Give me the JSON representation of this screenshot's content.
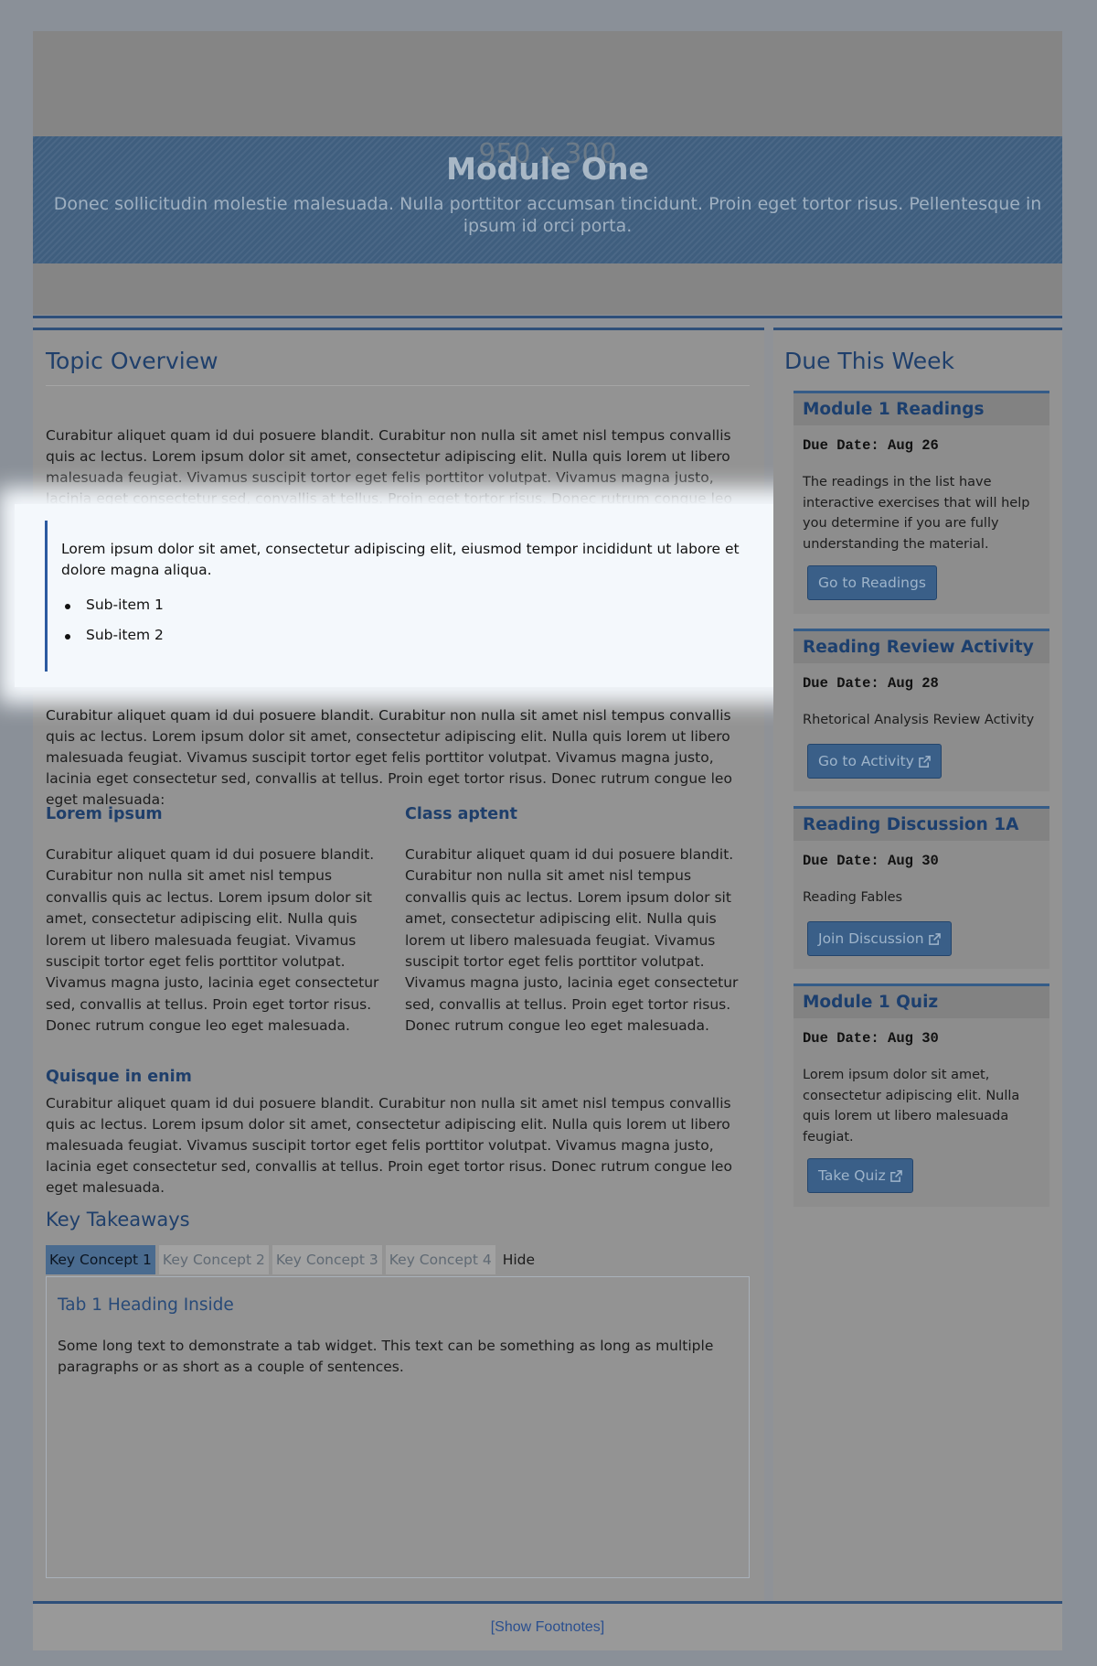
{
  "banner": {
    "placeholder": "950 x 300",
    "title": "Module One",
    "subtitle": "Donec sollicitudin molestie malesuada. Nulla porttitor accumsan tincidunt. Proin eget tortor risus. Pellentesque in ipsum id orci porta."
  },
  "topic": {
    "title": "Topic Overview",
    "para1": "Curabitur aliquet quam id dui posuere blandit. Curabitur non nulla sit amet nisl tempus convallis quis ac lectus. Lorem ipsum dolor sit amet, consectetur adipiscing elit. Nulla quis lorem ut libero malesuada feugiat. Vivamus suscipit tortor eget felis porttitor volutpat. Vivamus magna justo, lacinia eget consectetur sed, convallis at tellus. Proin eget tortor risus. Donec rutrum congue leo eget malesuada.",
    "callout_text": "Lorem ipsum dolor sit amet, consectetur adipiscing elit, eiusmod tempor incididunt ut labore et dolore magna aliqua.",
    "callout_items": [
      "Sub-item 1",
      "Sub-item 2"
    ],
    "para2": "Curabitur aliquet quam id dui posuere blandit. Curabitur non nulla sit amet nisl tempus convallis quis ac lectus. Lorem ipsum dolor sit amet, consectetur adipiscing elit. Nulla quis lorem ut libero malesuada feugiat. Vivamus suscipit tortor eget felis porttitor volutpat. Vivamus magna justo, lacinia eget consectetur sed, convallis at tellus. Proin eget tortor risus. Donec rutrum congue leo eget malesuada:",
    "col_left_heading": "Lorem ipsum",
    "col_left_text": "Curabitur aliquet quam id dui posuere blandit. Curabitur non nulla sit amet nisl tempus convallis quis ac lectus. Lorem ipsum dolor sit amet, consectetur adipiscing elit. Nulla quis lorem ut libero malesuada feugiat. Vivamus suscipit tortor eget felis porttitor volutpat. Vivamus magna justo, lacinia eget consectetur sed, convallis at tellus. Proin eget tortor risus. Donec rutrum congue leo eget malesuada.",
    "col_right_heading": "Class aptent",
    "col_right_text": "Curabitur aliquet quam id dui posuere blandit. Curabitur non nulla sit amet nisl tempus convallis quis ac lectus. Lorem ipsum dolor sit amet, consectetur adipiscing elit. Nulla quis lorem ut libero malesuada feugiat. Vivamus suscipit tortor eget felis porttitor volutpat. Vivamus magna justo, lacinia eget consectetur sed, convallis at tellus. Proin eget tortor risus. Donec rutrum congue leo eget malesuada.",
    "quisque_heading": "Quisque in enim",
    "para3": "Curabitur aliquet quam id dui posuere blandit. Curabitur non nulla sit amet nisl tempus convallis quis ac lectus. Lorem ipsum dolor sit amet, consectetur adipiscing elit. Nulla quis lorem ut libero malesuada feugiat. Vivamus suscipit tortor eget felis porttitor volutpat. Vivamus magna justo, lacinia eget consectetur sed, convallis at tellus. Proin eget tortor risus. Donec rutrum congue leo eget malesuada."
  },
  "key_takeaways": {
    "title": "Key Takeaways",
    "tabs": [
      "Key Concept 1",
      "Key Concept 2",
      "Key Concept 3",
      "Key Concept 4"
    ],
    "hide_label": "Hide",
    "panel_heading": "Tab 1 Heading Inside",
    "panel_text": "Some long text to demonstrate a tab widget. This text can be something as long as multiple paragraphs or as short as a couple of sentences."
  },
  "sidebar": {
    "title": "Due This Week",
    "cards": [
      {
        "title": "Module 1 Readings",
        "due": "Due Date: Aug 26",
        "desc": "The readings in the list have interactive exercises that will help you determine if you are fully understanding the material.",
        "button": "Go to Readings"
      },
      {
        "title": "Reading Review Activity",
        "due": "Due Date: Aug 28",
        "desc": "Rhetorical Analysis Review Activity",
        "button": "Go to Activity"
      },
      {
        "title": "Reading Discussion 1A",
        "due": "Due Date: Aug 30",
        "desc": "Reading Fables",
        "button": "Join Discussion"
      },
      {
        "title": "Module 1 Quiz",
        "due": "Due Date: Aug 30",
        "desc": "Lorem ipsum dolor sit amet, consectetur adipiscing elit. Nulla quis lorem ut libero malesuada feugiat.",
        "button": "Take Quiz"
      }
    ]
  },
  "footer": {
    "show_footnotes": "[Show Footnotes]"
  },
  "colors": {
    "accent": "#2e4f7a",
    "button": "#3a5f88",
    "callout_border": "#2c5aa0"
  }
}
